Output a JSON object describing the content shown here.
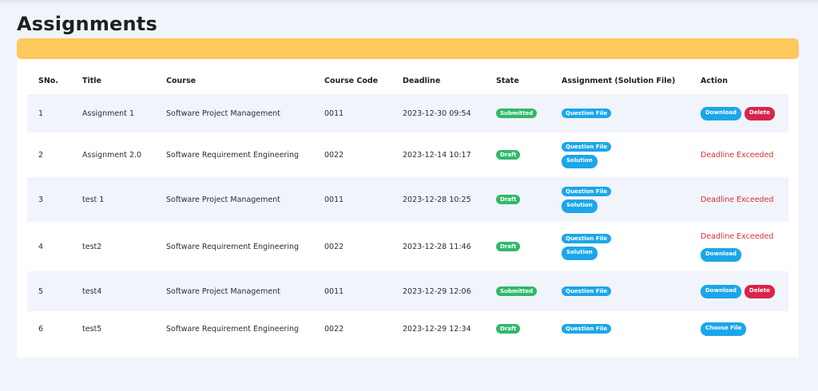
{
  "page": {
    "title": "Assignments"
  },
  "colors": {
    "banner": "#fdc95c",
    "blue": "#1ba6ea",
    "green": "#2fb96a",
    "red": "#d8254b",
    "exceeded": "#dc2f2f"
  },
  "table": {
    "headers": [
      "SNo.",
      "Title",
      "Course",
      "Course Code",
      "Deadline",
      "State",
      "Assignment (Solution File)",
      "Action"
    ],
    "rows": [
      {
        "sno": "1",
        "title": "Assignment 1",
        "course": "Software Project Management",
        "code": "0011",
        "deadline": "2023-12-30 09:54",
        "state": "Submitted",
        "files": [
          "Question File"
        ],
        "actions": [
          "Download",
          "Delete"
        ]
      },
      {
        "sno": "2",
        "title": "Assignment 2.0",
        "course": "Software Requirement Engineering",
        "code": "0022",
        "deadline": "2023-12-14 10:17",
        "state": "Draft",
        "files": [
          "Question File",
          "Solution"
        ],
        "status": "Deadline Exceeded"
      },
      {
        "sno": "3",
        "title": "test 1",
        "course": "Software Project Management",
        "code": "0011",
        "deadline": "2023-12-28 10:25",
        "state": "Draft",
        "files": [
          "Question File",
          "Solution"
        ],
        "status": "Deadline Exceeded"
      },
      {
        "sno": "4",
        "title": "test2",
        "course": "Software Requirement Engineering",
        "code": "0022",
        "deadline": "2023-12-28 11:46",
        "state": "Draft",
        "files": [
          "Question File",
          "Solution"
        ],
        "status": "Deadline Exceeded",
        "actions": [
          "Download"
        ]
      },
      {
        "sno": "5",
        "title": "test4",
        "course": "Software Project Management",
        "code": "0011",
        "deadline": "2023-12-29 12:06",
        "state": "Submitted",
        "files": [
          "Question File"
        ],
        "actions": [
          "Download",
          "Delete"
        ]
      },
      {
        "sno": "6",
        "title": "test5",
        "course": "Software Requirement Engineering",
        "code": "0022",
        "deadline": "2023-12-29 12:34",
        "state": "Draft",
        "files": [
          "Question File"
        ],
        "actions": [
          "Choose File"
        ]
      }
    ]
  }
}
